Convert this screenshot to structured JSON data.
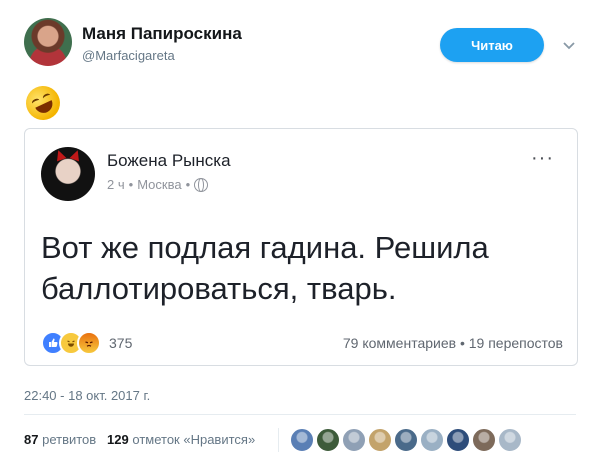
{
  "tweet": {
    "author_name": "Маня Папироскина",
    "author_handle": "@Marfacigareta",
    "follow_label": "Читаю",
    "timestamp": "22:40 - 18 окт. 2017 г.",
    "retweets_count": "87",
    "retweets_label": "ретвитов",
    "likes_count": "129",
    "likes_label": "отметок «Нравится»"
  },
  "fb_post": {
    "author": "Божена Рынска",
    "time": "2 ч",
    "location": "Москва",
    "text": "Вот же подлая гадина. Решила баллотироваться, тварь.",
    "reactions_count": "375",
    "comments_shares": "79 комментариев • 19 перепостов",
    "more_glyph": "···"
  },
  "icons": {
    "chevron": "chevron-down-icon",
    "emoji": "rolling-laughing-emoji-icon",
    "globe": "globe-icon",
    "reactions": [
      "like-reaction-icon",
      "haha-reaction-icon",
      "angry-reaction-icon"
    ]
  },
  "liker_colors": [
    "#5a7fb5",
    "#3d5b3a",
    "#8fa0b5",
    "#c3a36b",
    "#4a6a8a",
    "#9ab0c4",
    "#2e4d7a",
    "#7d6a5a",
    "#a8b8c8"
  ],
  "colors": {
    "accent": "#1da1f2",
    "text_secondary": "#657786"
  }
}
